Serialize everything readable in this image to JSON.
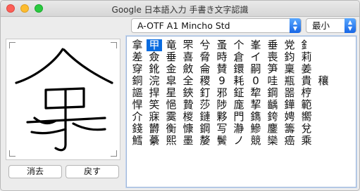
{
  "window": {
    "title": "Google 日本語入力 手書き文字認識"
  },
  "font_select": {
    "value": "A-OTF A1 Mincho Std"
  },
  "size_select": {
    "value": "最小"
  },
  "buttons": {
    "clear": "消去",
    "undo": "戻す"
  },
  "candidates": [
    [
      "拿",
      "甲",
      "竜",
      "罘",
      "兮",
      "蚤",
      "个",
      "峯",
      "垂",
      "党",
      "釒"
    ],
    [
      "差",
      "僉",
      "垂",
      "喜",
      "脅",
      "時",
      "倉",
      "イ",
      "喪",
      "鈞",
      "莉"
    ],
    [
      "穿",
      "鈋",
      "金",
      "斂",
      "侖",
      "賛",
      "鐶",
      "嗣",
      "笋",
      "稟",
      "姜"
    ],
    [
      "銅",
      "浣",
      "皐",
      "全",
      "稷",
      "9",
      "耗",
      "0",
      "哇",
      "瓶",
      "貴",
      "穰"
    ],
    [
      "謳",
      "捍",
      "星",
      "鋏",
      "釘",
      "邪",
      "鉦",
      "犂",
      "鋼",
      "噐",
      "梈"
    ],
    [
      "悍",
      "笑",
      "悒",
      "贄",
      "莎",
      "陟",
      "庬",
      "挈",
      "齲",
      "鏵",
      "範"
    ],
    [
      "介",
      "寐",
      "霙",
      "椶",
      "鏈",
      "夥",
      "門",
      "鐫",
      "銙",
      "娉",
      "嚮"
    ],
    [
      "錢",
      "欝",
      "衡",
      "慷",
      "鋼",
      "写",
      "瀞",
      "鰺",
      "鏖",
      "籌",
      "兌"
    ],
    [
      "鱈",
      "虆",
      "熙",
      "墨",
      "嫠",
      "鬢",
      "ノ",
      "競",
      "欒",
      "癌",
      "乘"
    ]
  ],
  "selected_index": [
    0,
    1
  ],
  "icons": {
    "canvas_corners": "bracket-corner-icon"
  }
}
